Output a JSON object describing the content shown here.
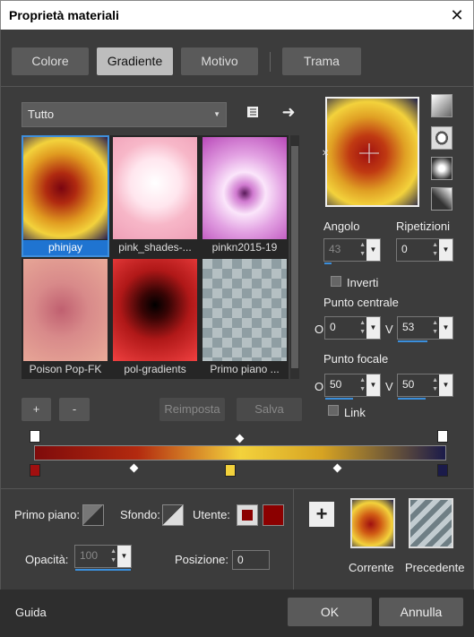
{
  "window": {
    "title": "Proprietà materiali",
    "close_glyph": "✕"
  },
  "tabs": [
    {
      "label": "Colore",
      "active": false
    },
    {
      "label": "Gradiente",
      "active": true
    },
    {
      "label": "Motivo",
      "active": false
    },
    {
      "label": "Trama",
      "active": false
    }
  ],
  "filter": {
    "selected": "Tutto",
    "arrow": "▼"
  },
  "icons": {
    "book": "book-icon",
    "arrow": "arrow-right-icon"
  },
  "gallery": [
    {
      "caption": "phinjay",
      "selected": true
    },
    {
      "caption": "pink_shades-...",
      "selected": false
    },
    {
      "caption": "pinkn2015-19",
      "selected": false
    },
    {
      "caption": "Poison Pop-FK",
      "selected": false
    },
    {
      "caption": "pol-gradients",
      "selected": false
    },
    {
      "caption": "Primo piano ...",
      "selected": false
    }
  ],
  "buttons": {
    "add": "+",
    "remove": "-",
    "reset": "Reimposta",
    "save": "Salva",
    "ok": "OK",
    "cancel": "Annulla",
    "help": "Guida"
  },
  "params": {
    "angle_label": "Angolo",
    "angle": "43",
    "repeats_label": "Ripetizioni",
    "repeats": "0",
    "invert_label": "Inverti",
    "center_label": "Punto centrale",
    "center_h_label": "O",
    "center_h": "0",
    "center_v_label": "V",
    "center_v": "53",
    "focal_label": "Punto focale",
    "focal_h_label": "O",
    "focal_h": "50",
    "focal_v_label": "V",
    "focal_v": "50",
    "link_label": "Link"
  },
  "bottom": {
    "foreground_label": "Primo piano:",
    "background_label": "Sfondo:",
    "user_label": "Utente:",
    "opacity_label": "Opacità:",
    "opacity": "100",
    "position_label": "Posizione:",
    "position": "0",
    "current_label": "Corrente",
    "previous_label": "Precedente"
  },
  "colors": {
    "accent": "#1f74d1",
    "user_color": "#8b0000",
    "stop_left": "#a10f0f",
    "stop_mid": "#f3d23c",
    "stop_right": "#1b1b4a"
  }
}
